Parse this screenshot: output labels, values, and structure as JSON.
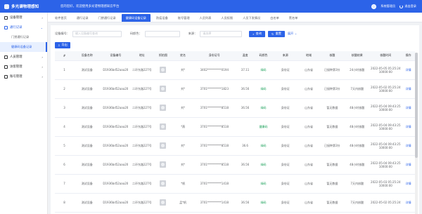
{
  "app": {
    "title": "多光谱物理感知",
    "welcome": "您的您好，欢迎使用多光谱物理感知云平台",
    "user": "系统管理员",
    "logout": "退出登录"
  },
  "colors": {
    "primary": "#2c63e8",
    "green": "#18a058"
  },
  "sidebar": {
    "items": [
      {
        "label": "设备管理",
        "icon": "device-icon",
        "arrow": "›"
      },
      {
        "label": "通行记录",
        "icon": "record-icon",
        "arrow": "⌄",
        "active": true
      },
      {
        "label": "门禁通行记录",
        "sub": true
      },
      {
        "label": "健康码设备记录",
        "sub": true,
        "active": true
      },
      {
        "label": "人员管理",
        "icon": "user-icon",
        "arrow": "›"
      },
      {
        "label": "访客管理",
        "icon": "visitor-icon",
        "arrow": "›"
      },
      {
        "label": "账号管理",
        "icon": "account-icon",
        "arrow": "›"
      }
    ]
  },
  "tabs": [
    "软件首页",
    "通行记录",
    "门禁通行记录",
    "健康码设备记录",
    "防疫设备",
    "账号管理",
    "人员列表",
    "人员权限",
    "人员下发情况",
    "白名单",
    "黑名单"
  ],
  "active_tab": 3,
  "search": {
    "device_no_label": "设备编号：",
    "device_no_placeholder": "输入设备编号查询",
    "code_color_label": "码颜色：",
    "code_color_placeholder": "",
    "source_label": "来源：",
    "source_placeholder": "请选择",
    "query_btn": "查询",
    "reset_btn": "重置",
    "expand": "展开"
  },
  "export_btn": "导出",
  "table": {
    "headers": [
      "#",
      "设备名称",
      "设备编号",
      "地址",
      "抓拍图",
      "姓名",
      "身份证号",
      "温度",
      "码颜色",
      "来源",
      "地域",
      "核酸",
      "核酸结果",
      "核酸时间",
      "操作"
    ],
    "rows": [
      {
        "n": "1",
        "name": "测试设备",
        "no": "D1936bd52aaa20",
        "addr": "二环东路227号",
        "pname": "刘*",
        "id": "3402**********0194",
        "temp": "37.11",
        "code": "绿码",
        "src": "身份证",
        "region": "山东省",
        "hs": "已接种第3针",
        "hsres": "24小时核酸",
        "time": "2022-05-05 05:25:24 10000:00",
        "op": "详情"
      },
      {
        "n": "2",
        "name": "测试设备",
        "no": "D1936bd52aaa20",
        "addr": "二环东路227号",
        "pname": "刘*",
        "id": "3701**********1823",
        "temp": "36.56",
        "code": "绿码",
        "src": "身份证",
        "region": "山东省",
        "hs": "已接种第3针",
        "hsres": "7天内核酸",
        "time": "2022-05-02 05:25:24 10000:00",
        "op": "详情"
      },
      {
        "n": "3",
        "name": "测试设备",
        "no": "D1936bd52aaa20",
        "addr": "二环东路227号",
        "pname": "刘*",
        "id": "3701**********8518",
        "temp": "36.56",
        "code": "绿码",
        "src": "身份证",
        "region": "山东省",
        "hs": "暂无数据",
        "hsres": "48小时核酸",
        "time": "2022-05-04 09:43:25 10000:00",
        "op": "详情"
      },
      {
        "n": "4",
        "name": "测试设备",
        "no": "D1936bd52aaa20",
        "addr": "二环东路227号",
        "pname": "*燕",
        "id": "3701**********8518",
        "temp": "",
        "code": "健康码",
        "src": "身份证",
        "region": "山东省",
        "hs": "暂无数据",
        "hsres": "48小时核酸",
        "time": "2022-05-04 09:43:25 10000:00",
        "op": "详情"
      },
      {
        "n": "5",
        "name": "测试设备",
        "no": "D1936bd52aaa20",
        "addr": "二环东路227号",
        "pname": "刘*",
        "id": "3701**********8518",
        "temp": "36.6",
        "code": "绿码",
        "src": "身份证",
        "region": "山东省",
        "hs": "已接种第3针",
        "hsres": "48小时核酸",
        "time": "2022-05-04 09:43:25 10000:00",
        "op": "详情"
      },
      {
        "n": "6",
        "name": "测试设备",
        "no": "D1936bd52aaa20",
        "addr": "二环东路227号",
        "pname": "刘*",
        "id": "3701**********8518",
        "temp": "36.56",
        "code": "绿码",
        "src": "身份证",
        "region": "山东省",
        "hs": "暂无数据",
        "hsres": "48小时核酸",
        "time": "2022-05-04 09:43:25 10000:00",
        "op": "详情"
      },
      {
        "n": "7",
        "name": "测试设备",
        "no": "D1936bd52aaa20",
        "addr": "二环东路227号",
        "pname": "*帆",
        "id": "3701**********1418",
        "temp": "",
        "code": "绿码",
        "src": "身份证",
        "region": "山东省",
        "hs": "暂无数据",
        "hsres": "7天内核酸",
        "time": "2022-05-03 05:25:24 10000:00",
        "op": "详情"
      },
      {
        "n": "8",
        "name": "测试设备",
        "no": "D1936bd52aaa20",
        "addr": "二环东路227号",
        "pname": "孟*帆",
        "id": "3701**********1418",
        "temp": "36.56",
        "code": "绿码",
        "src": "身份证",
        "region": "山东省",
        "hs": "暂无数据",
        "hsres": "7天内核酸",
        "time": "2022-05-02 05:25:24",
        "op": "详情"
      }
    ]
  }
}
